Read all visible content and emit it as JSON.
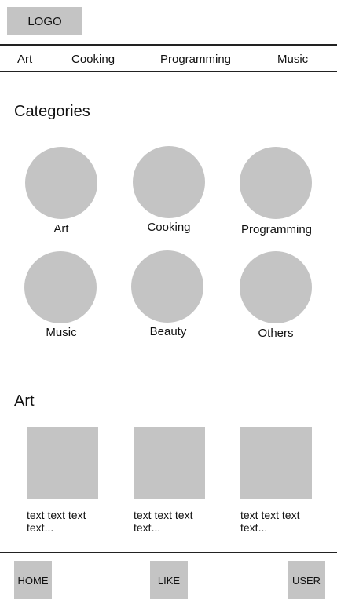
{
  "header": {
    "logo_label": "LOGO"
  },
  "nav": {
    "items": [
      "Art",
      "Cooking",
      "Programming",
      "Music"
    ]
  },
  "categories": {
    "title": "Categories",
    "items": [
      "Art",
      "Cooking",
      "Programming",
      "Music",
      "Beauty",
      "Others"
    ]
  },
  "art_section": {
    "title": "Art",
    "cards": [
      {
        "text": "text text text text..."
      },
      {
        "text": "text text text text..."
      },
      {
        "text": "text text text text..."
      }
    ]
  },
  "bottom_nav": {
    "home_label": "HOME",
    "like_label": "LIKE",
    "user_label": "USER"
  },
  "colors": {
    "placeholder": "#c4c4c4",
    "divider": "#222222"
  }
}
